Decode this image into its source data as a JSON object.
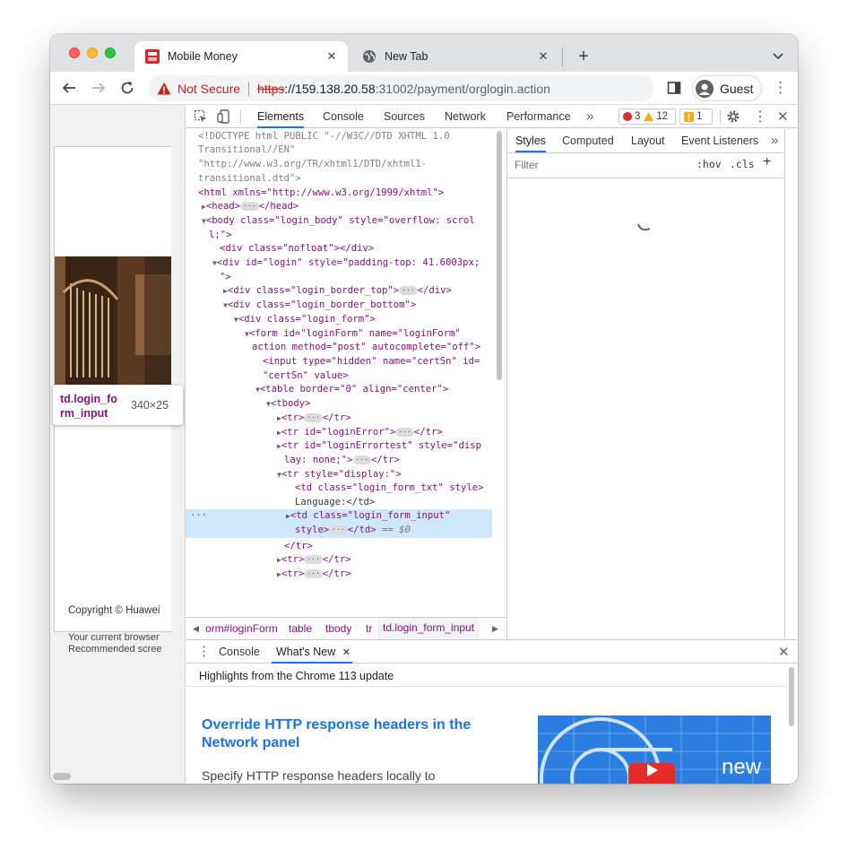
{
  "tabs": [
    {
      "title": "Mobile Money",
      "active": true
    },
    {
      "title": "New Tab",
      "active": false
    }
  ],
  "address": {
    "security_label": "Not Secure",
    "scheme": "https",
    "host_part": "://159.138.20.58",
    "path_part": ":31002/payment/orglogin.action"
  },
  "profile": {
    "label": "Guest"
  },
  "page": {
    "copyright": "Copyright © Huawei",
    "browser_note_line1": "Your current browser",
    "browser_note_line2": "Recommended scree",
    "inspect_tooltip": {
      "selector": "td.login_fo rm_input",
      "size": "340×25"
    }
  },
  "devtools": {
    "tabs": [
      "Elements",
      "Console",
      "Sources",
      "Network",
      "Performance"
    ],
    "more": "»",
    "counts": {
      "errors": "3",
      "warnings": "12",
      "issues": "1"
    },
    "dom_lines": [
      "<!DOCTYPE html PUBLIC \"-//W3C//DTD XHTML 1.0",
      "Transitional//EN\"",
      "\"http://www.w3.org/TR/xhtml1/DTD/xhtml1-",
      "transitional.dtd\">",
      "<html xmlns=\"http://www.w3.org/1999/xhtml\">",
      "<head>",
      "</head>",
      "<body class=\"login_body\" style=\"overflow: scrol",
      "l;\">",
      "<div class=\"nofloat\"></div>",
      "<div id=\"login\" style=\"padding-top: 41.6003px;",
      "\">",
      "<div class=\"login_border_top\">",
      "</div>",
      "<div class=\"login_border_bottom\">",
      "<div class=\"login_form\">",
      "<form id=\"loginForm\" name=\"loginForm\"",
      "action method=\"post\" autocomplete=\"off\">",
      "<input type=\"hidden\" name=\"certSn\" id=",
      "\"certSn\" value>",
      "<table border=\"0\" align=\"center\">",
      "<tbody>",
      "<tr>",
      "</tr>",
      "<tr id=\"loginError\">",
      "<tr id=\"loginErrortest\" style=\"disp",
      "lay: none;\">",
      "<tr style=\"display:\">",
      "<td class=\"login_form_txt\" style>",
      "Language:</td>",
      "<td class=\"login_form_input\"",
      "style>",
      "</td>",
      "== $0",
      "</tr>",
      "<tr>",
      "</tr>"
    ],
    "breadcrumb": [
      "orm#loginForm",
      "table",
      "tbody",
      "tr",
      "td.login_form_input"
    ],
    "styles_tabs": [
      "Styles",
      "Computed",
      "Layout",
      "Event Listeners"
    ],
    "filter_placeholder": "Filter",
    "hov": ":hov",
    "cls": ".cls",
    "drawer_tabs": [
      "Console",
      "What's New"
    ],
    "whats_new": {
      "highlights": "Highlights from the Chrome 113 update",
      "title": "Override HTTP response headers in the Network panel",
      "body": "Specify HTTP response headers locally to experiment with different values.",
      "image_word": "new"
    }
  },
  "colors": {
    "accent": "#1a73e8",
    "error": "#d93025",
    "warning": "#f9ab00",
    "not_secure": "#c5221f"
  }
}
